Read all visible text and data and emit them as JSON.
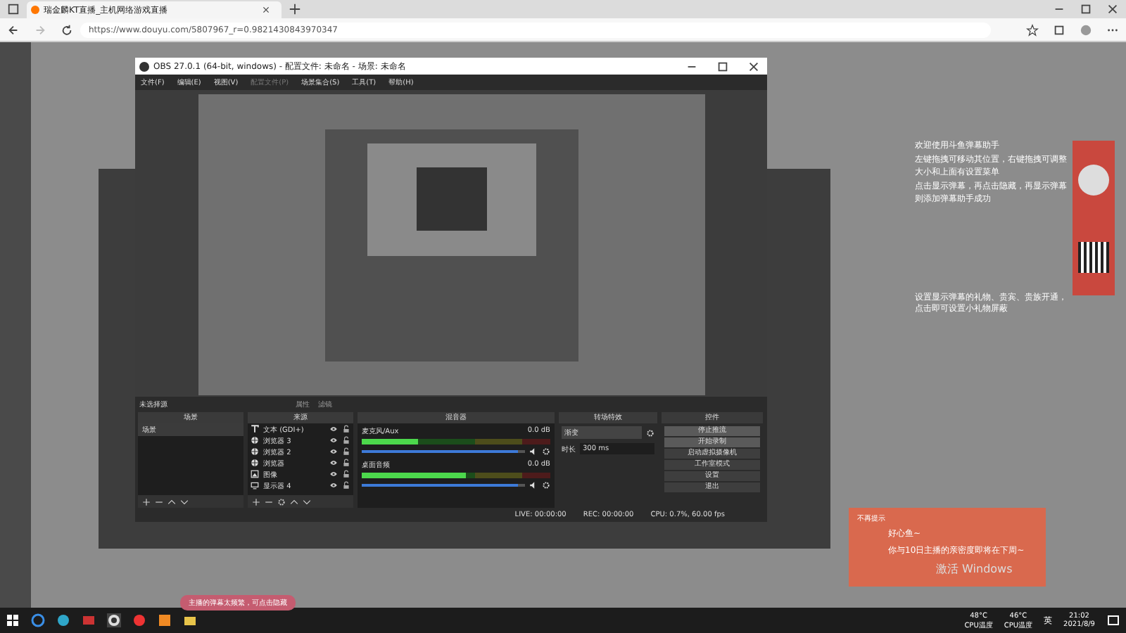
{
  "browser": {
    "tab_title": "瑞金麟KT直播_主机网络游戏直播",
    "url": "https://www.douyu.com/5807967_r=0.9821430843970347"
  },
  "obs": {
    "title": "OBS 27.0.1 (64-bit, windows) - 配置文件: 未命名 - 场景: 未命名",
    "menu": [
      {
        "label": "文件(F)",
        "disabled": false
      },
      {
        "label": "编辑(E)",
        "disabled": false
      },
      {
        "label": "视图(V)",
        "disabled": false
      },
      {
        "label": "配置文件(P)",
        "disabled": true
      },
      {
        "label": "场景集合(S)",
        "disabled": false
      },
      {
        "label": "工具(T)",
        "disabled": false
      },
      {
        "label": "帮助(H)",
        "disabled": false
      }
    ],
    "toolbar": {
      "source_label": "未选择源",
      "buttons": [
        "属性",
        "滤镜"
      ]
    },
    "docks": {
      "scenes": "场景",
      "sources": "来源",
      "mixer": "混音器",
      "transitions": "转场特效",
      "controls": "控件"
    },
    "scenes": [
      {
        "name": "场景",
        "selected": true
      }
    ],
    "sources": [
      {
        "name": "文本 (GDI+)",
        "kind": "text"
      },
      {
        "name": "浏览器 3",
        "kind": "browser"
      },
      {
        "name": "浏览器 2",
        "kind": "browser"
      },
      {
        "name": "浏览器",
        "kind": "browser"
      },
      {
        "name": "图像",
        "kind": "image"
      },
      {
        "name": "显示器 4",
        "kind": "display"
      }
    ],
    "mixer": [
      {
        "name": "麦克风/Aux",
        "reading": "0.0 dB",
        "level": 0.3,
        "fader": {
          "level": 0.96
        }
      },
      {
        "name": "桌面音频",
        "reading": "0.0 dB",
        "level": 0.55,
        "fader": {
          "level": 0.96
        }
      }
    ],
    "transition": {
      "value": "渐变",
      "duration_label": "时长",
      "duration": "300 ms"
    },
    "controls": [
      {
        "label": "停止推流",
        "selected": true
      },
      {
        "label": "开始录制",
        "selected": true
      },
      {
        "label": "启动虚拟摄像机",
        "selected": false
      },
      {
        "label": "工作室模式",
        "selected": false
      },
      {
        "label": "设置",
        "selected": false
      },
      {
        "label": "退出",
        "selected": false
      }
    ],
    "status": {
      "live": "LIVE: 00:00:00",
      "rec": "REC: 00:00:00",
      "cpu": "CPU: 0.7%, 60.00 fps"
    }
  },
  "guide": [
    "欢迎使用斗鱼弹幕助手",
    "左键拖拽可移动其位置，右键拖拽可调整大小和上面有设置菜单",
    "点击显示弹幕，再点击隐藏，再显示弹幕则添加弹幕助手成功",
    "设置显示弹幕的礼物、贵宾、贵族开通，点击即可设置小礼物屏蔽"
  ],
  "popup": {
    "header": "不再提示",
    "greeting": "好心鱼~",
    "message": "你与10日主播的亲密度即将在下周~"
  },
  "activation": "激活 Windows",
  "notice": "主播的弹幕太频繁，可点击隐藏",
  "taskbar": {
    "temps": [
      {
        "value": "48°C",
        "label": "CPU温度"
      },
      {
        "value": "46°C",
        "label": "CPU温度"
      }
    ],
    "ime": "英",
    "time": "21:02",
    "date": "2021/8/9"
  }
}
